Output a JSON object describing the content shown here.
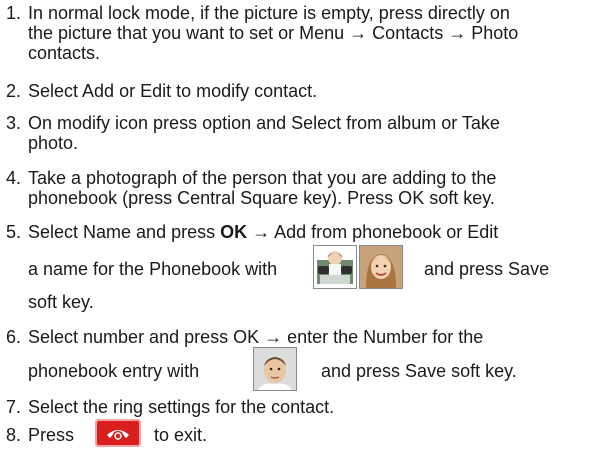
{
  "steps": [
    {
      "number": "1.",
      "lines": [
        "In normal lock mode, if the picture is empty, press directly on",
        "the picture that you want to set or Menu → Contacts → Photo",
        "contacts."
      ]
    },
    {
      "number": "2.",
      "lines": [
        "Select Add or Edit to modify contact."
      ]
    },
    {
      "number": "3.",
      "lines": [
        "On modify icon press option and Select from album or Take",
        "photo."
      ]
    },
    {
      "number": "4.",
      "lines": [
        "Take a photograph of the person that you are adding to the",
        "phonebook (press Central Square key). Press OK soft key."
      ]
    },
    {
      "number": "5.",
      "line1_pre": "Select Name and press ",
      "line1_bold": "OK",
      "line1_post": " → Add from phonebook or Edit",
      "line2_pre": "a name for the Phonebook with",
      "line2_post": "and press Save",
      "line3": "soft key."
    },
    {
      "number": "6.",
      "line1": "Select number and press OK → enter the Number for the",
      "line2_pre": "phonebook entry with",
      "line2_post": "and press Save soft key."
    },
    {
      "number": "7.",
      "lines": [
        "Select the ring settings for the contact."
      ]
    },
    {
      "number": "8.",
      "pre": "Press",
      "post": "to exit."
    }
  ],
  "icons": {
    "contact_photo_set": [
      "photo-icon",
      "portrait-icon"
    ],
    "portrait_thumb": "portrait-icon",
    "end_key": "end-call-key-icon"
  }
}
